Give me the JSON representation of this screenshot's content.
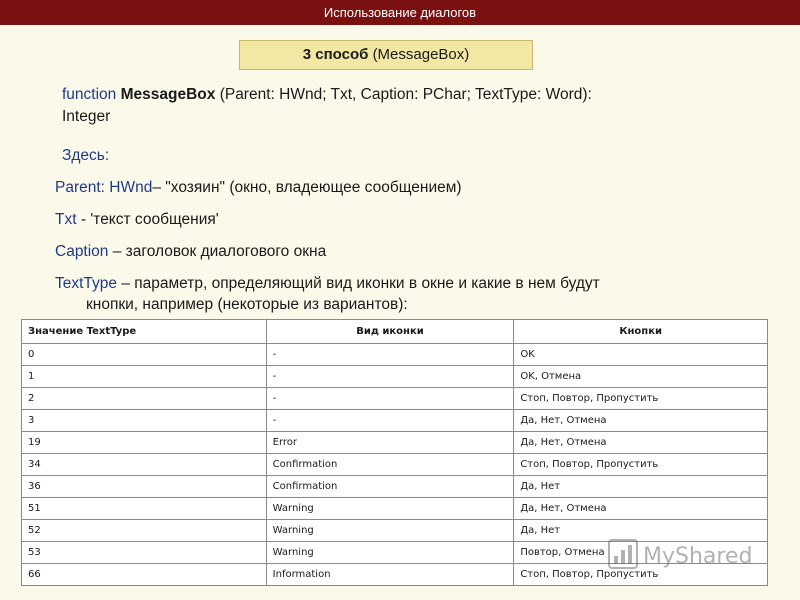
{
  "header": {
    "title": "Использование диалогов"
  },
  "method": {
    "number": "3 способ",
    "name": "(MessageBox)"
  },
  "signature": {
    "keyword": "function",
    "name": "MessageBox",
    "params": "(Parent: HWnd; Txt, Caption: PChar; TextType: Word):",
    "return_type": "Integer"
  },
  "intro": "Здесь:",
  "params": [
    {
      "name": "Parent: HWnd",
      "desc": "– \"хозяин\" (окно, владеющее сообщением)"
    },
    {
      "name": "Txt",
      "desc": " - 'текст сообщения'"
    },
    {
      "name": "Caption",
      "desc": " – заголовок диалогового окна"
    },
    {
      "name": "TextType",
      "desc": " – параметр, определяющий вид иконки в окне и какие в нем будут",
      "desc2": "кнопки, например (некоторые из вариантов):"
    }
  ],
  "table": {
    "headers": [
      "Значение TextType",
      "Вид иконки",
      "Кнопки"
    ],
    "rows": [
      [
        "0",
        "-",
        "OK"
      ],
      [
        "1",
        "-",
        "OK, Отмена"
      ],
      [
        "2",
        "-",
        "Стоп, Повтор, Пропустить"
      ],
      [
        "3",
        "-",
        "Да, Нет, Отмена"
      ],
      [
        "19",
        "Error",
        "Да, Нет, Отмена"
      ],
      [
        "34",
        "Confirmation",
        "Стоп, Повтор, Пропустить"
      ],
      [
        "36",
        "Confirmation",
        "Да, Нет"
      ],
      [
        "51",
        "Warning",
        "Да, Нет, Отмена"
      ],
      [
        "52",
        "Warning",
        "Да, Нет"
      ],
      [
        "53",
        "Warning",
        "Повтор, Отмена"
      ],
      [
        "66",
        "Information",
        "Стоп, Повтор, Пропустить"
      ]
    ]
  },
  "watermark": {
    "text": "MyShared",
    "icon": "bar-chart-logo-icon"
  },
  "colors": {
    "topbar": "#7a1010",
    "background": "#fbf9ea",
    "box": "#f2e7a3",
    "keyword_blue": "#1f3a8a"
  }
}
